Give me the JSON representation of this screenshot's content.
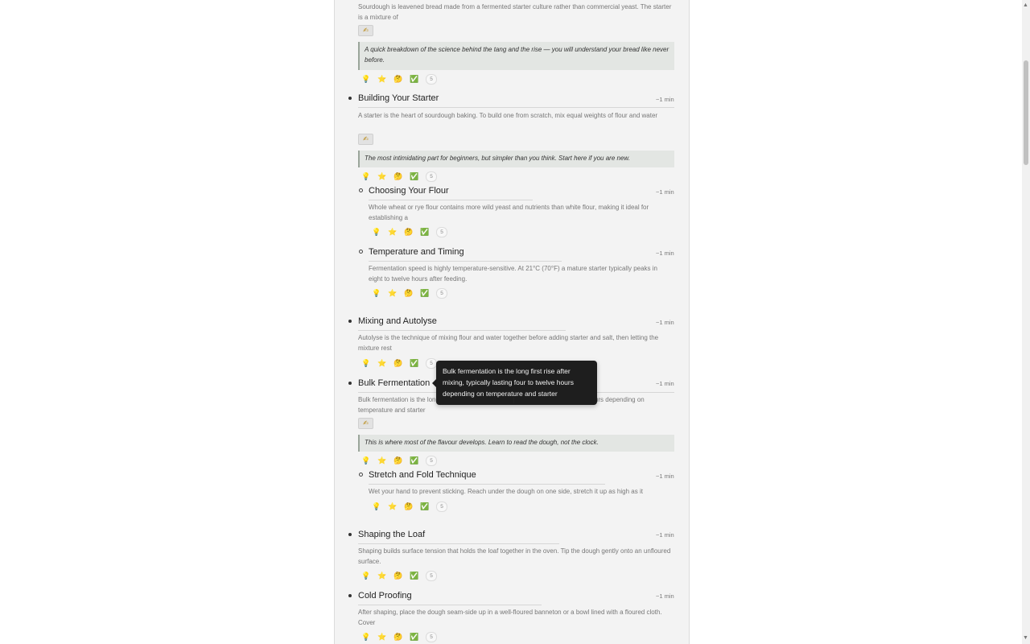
{
  "reactions": {
    "icons": [
      "💡",
      "⭐",
      "🤔",
      "✅"
    ],
    "count": "5"
  },
  "edit_icon": "✍",
  "top": {
    "body": "Sourdough is leavened bread made from a fermented starter culture rather than commercial yeast. The starter is a mixture of",
    "quote": "A quick breakdown of the science behind the tang and the rise — you will understand your bread like never before."
  },
  "sections": {
    "starter": {
      "title": "Building Your Starter",
      "time": "~1 min",
      "body": "A starter is the heart of sourdough baking. To build one from scratch, mix equal weights of flour and water",
      "quote": "The most intimidating part for beginners, but simpler than you think. Start here if you are new."
    },
    "flour": {
      "title": "Choosing Your Flour",
      "time": "~1 min",
      "body": "Whole wheat or rye flour contains more wild yeast and nutrients than white flour, making it ideal for establishing a"
    },
    "temperature": {
      "title": "Temperature and Timing",
      "time": "~1 min",
      "body": "Fermentation speed is highly temperature-sensitive. At 21°C (70°F) a mature starter typically peaks in eight to twelve hours after feeding."
    },
    "mixing": {
      "title": "Mixing and Autolyse",
      "time": "~1 min",
      "body": "Autolyse is the technique of mixing flour and water together before adding starter and salt, then letting the mixture rest"
    },
    "bulk": {
      "title": "Bulk Fermentation",
      "time": "~1 min",
      "body": "Bulk fermentation is the long first rise after mixing, typically lasting four to twelve hours depending on temperature and starter",
      "quote": "This is where most of the flavour develops. Learn to read the dough, not the clock."
    },
    "stretch": {
      "title": "Stretch and Fold Technique",
      "time": "~1 min",
      "body": "Wet your hand to prevent sticking. Reach under the dough on one side, stretch it up as high as it"
    },
    "shaping": {
      "title": "Shaping the Loaf",
      "time": "~1 min",
      "body": "Shaping builds surface tension that holds the loaf together in the oven. Tip the dough gently onto an unfloured surface."
    },
    "cold": {
      "title": "Cold Proofing",
      "time": "~1 min",
      "body": "After shaping, place the dough seam-side up in a well-floured banneton or a bowl lined with a floured cloth. Cover"
    }
  },
  "tooltip": {
    "text": "Bulk fermentation is the long first rise after mixing, typically lasting four to twelve hours depending on temperature and starter"
  }
}
